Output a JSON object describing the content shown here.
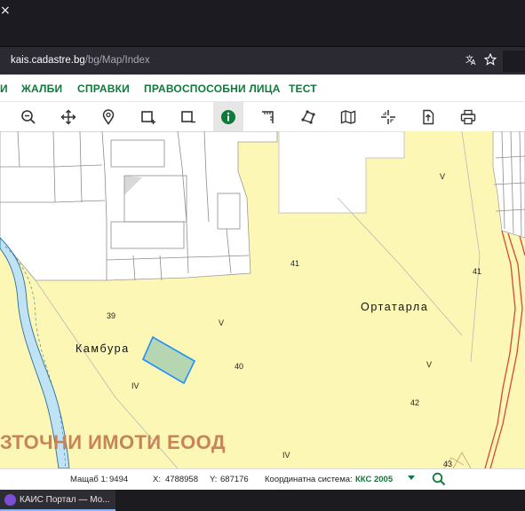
{
  "browser": {
    "title_glyph": "×",
    "url_host": "kais.cadastre.bg",
    "url_path": "/bg/Map/Index",
    "translate_icon": "translate-icon",
    "bookmark_icon": "star-icon"
  },
  "menu": {
    "items": [
      "И",
      "ЖАЛБИ",
      "СПРАВКИ",
      "ПРАВОСПОСОБНИ ЛИЦА",
      "ТЕСТ"
    ]
  },
  "toolbar": {
    "tools": [
      "zoom-out-icon",
      "pan-icon",
      "locate-pin-icon",
      "select-rect-icon",
      "deselect-rect-icon",
      "info-icon",
      "measure-distance-icon",
      "measure-area-icon",
      "layers-map-icon",
      "crosshair-icon",
      "export-icon",
      "print-icon"
    ],
    "active_tool": "info-icon"
  },
  "map": {
    "places": [
      "Камбура",
      "Ортатарла"
    ],
    "labels": [
      "39",
      "40",
      "41",
      "41",
      "42",
      "43",
      "V",
      "V",
      "V",
      "IV",
      "IV"
    ],
    "watermark": "ЗТОЧНИ ИМОТИ ЕООД",
    "colors": {
      "land": "#fdf7b6",
      "river": "#bfe3f5",
      "selected_fill": "#b6d6b2",
      "selected_border": "#1e90ff",
      "boundary": "#d24a3a"
    }
  },
  "status": {
    "scale_label": "Мащаб 1:",
    "scale_value": "9494",
    "x_label": "X:",
    "x_value": "4788958",
    "y_label": "Y:",
    "y_value": "687176",
    "crs_label": "Координатна система:",
    "crs_value": "ККС 2005"
  },
  "taskbar": {
    "app_title": "КАИС Портал — Мо..."
  }
}
